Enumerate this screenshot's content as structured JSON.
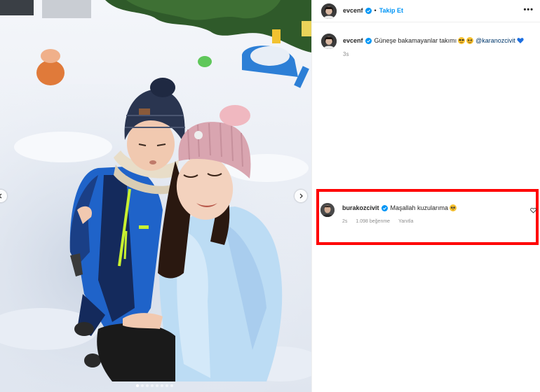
{
  "post": {
    "username": "evcenf",
    "separator": "•",
    "follow_label": "Takip Et",
    "more_label": "•••",
    "caption": {
      "username": "evcenf",
      "text": "Güneşe bakamayanlar takımı",
      "mention": "@karanozcivit",
      "time": "3s"
    }
  },
  "comment": {
    "username": "burakozcivit",
    "text": "Maşallah kuzularıma",
    "time": "2s",
    "likes": "1.098 beğenme",
    "reply_label": "Yanıtla"
  },
  "icons": {
    "verified": "verified-badge-icon",
    "heart": "heart-outline-icon",
    "arrow_left": "chevron-left-icon",
    "arrow_right": "chevron-right-icon",
    "more": "more-horizontal-icon"
  },
  "colors": {
    "link_blue": "#0095f6",
    "mention_blue": "#00376b",
    "highlight_red": "#ff0000",
    "meta_gray": "#8e8e8e"
  }
}
